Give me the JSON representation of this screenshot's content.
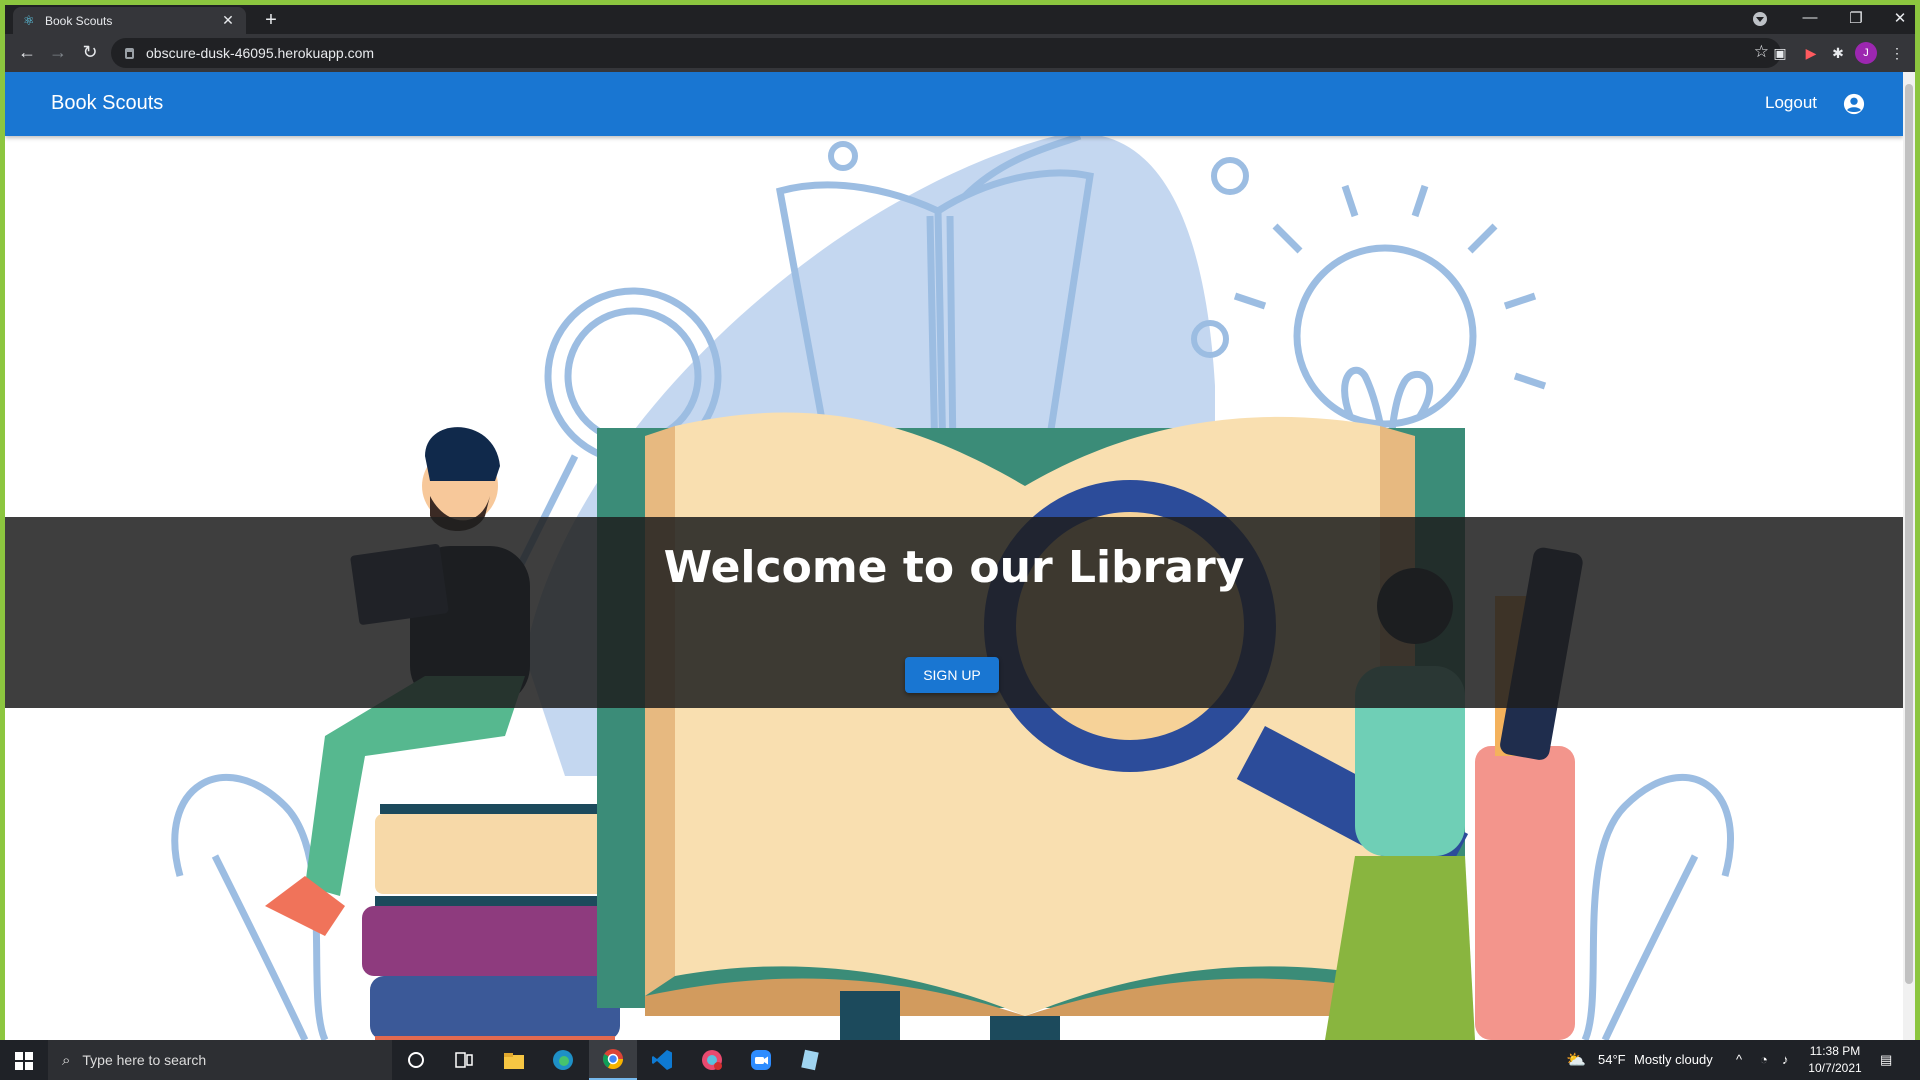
{
  "browser": {
    "tab_title": "Book Scouts",
    "tab_close": "✕",
    "new_tab": "+",
    "url": "obscure-dusk-46095.herokuapp.com",
    "avatar_letter": "J",
    "window_controls": {
      "minimize": "—",
      "restore": "❐",
      "close": "✕"
    }
  },
  "app": {
    "brand": "Book Scouts",
    "logout_label": "Logout"
  },
  "hero": {
    "heading": "Welcome to our Library",
    "signup_label": "SIGN UP"
  },
  "taskbar": {
    "search_placeholder": "Type here to search",
    "weather_temp": "54°F",
    "weather_desc": "Mostly cloudy",
    "time": "11:38 PM",
    "date": "10/7/2021"
  },
  "colors": {
    "appbar": "#1976d2",
    "button": "#1976d2",
    "banner_overlay": "#1e1e1e",
    "window_border": "#8cc63f"
  }
}
